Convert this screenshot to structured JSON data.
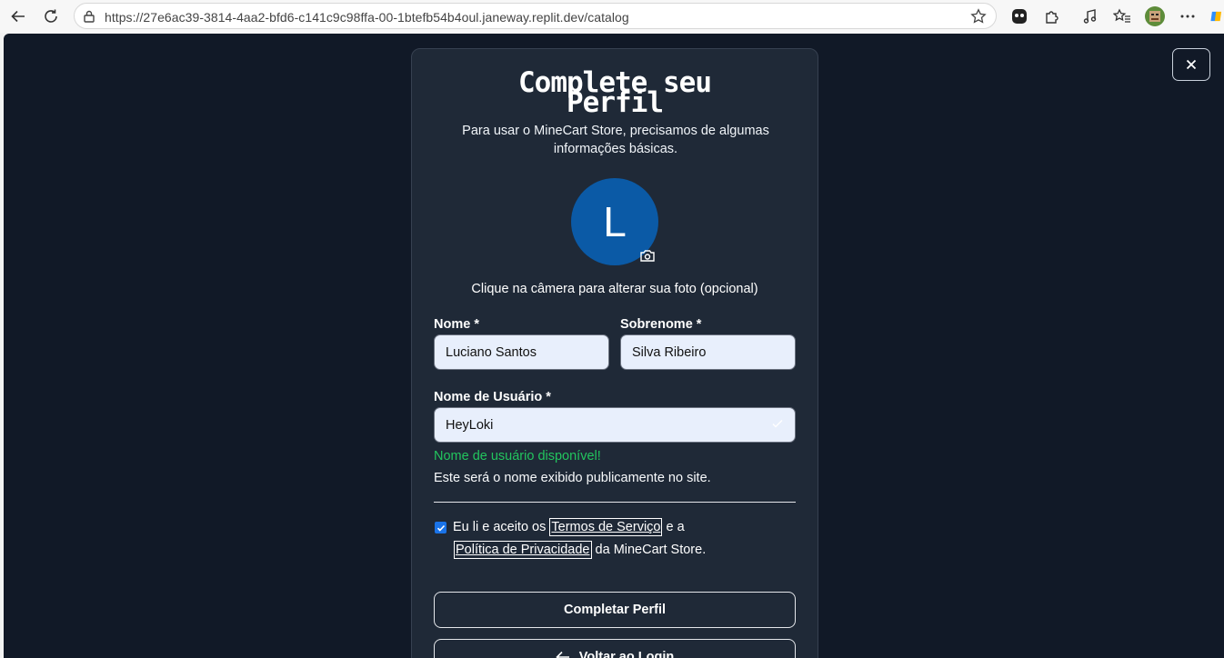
{
  "browser": {
    "url": "https://27e6ac39-3814-4aa2-bfd6-c141c9c98ffa-00-1btefb54b4oul.janeway.replit.dev/catalog"
  },
  "modal": {
    "title_line1": "Complete seu",
    "title_line2": "Perfil",
    "subtitle": "Para usar o MineCart Store, precisamos de algumas informações básicas.",
    "avatar_initial": "L",
    "avatar_color": "#0b5aa6",
    "photo_hint": "Clique na câmera para alterar sua foto (opcional)",
    "first_name_label": "Nome *",
    "first_name_value": "Luciano Santos",
    "last_name_label": "Sobrenome *",
    "last_name_value": "Silva Ribeiro",
    "username_label": "Nome de Usuário *",
    "username_value": "HeyLoki",
    "username_status": "Nome de usuário disponível!",
    "username_status_color": "#22c55e",
    "username_hint": "Este será o nome exibido publicamente no site.",
    "terms": {
      "checked": true,
      "prefix": "Eu li e aceito os",
      "terms_link": "Termos de Serviço",
      "middle": "e a",
      "privacy_link": "Política de Privacidade",
      "suffix": "da MineCart Store."
    },
    "submit_label": "Completar Perfil",
    "back_label": "Voltar ao Login"
  }
}
